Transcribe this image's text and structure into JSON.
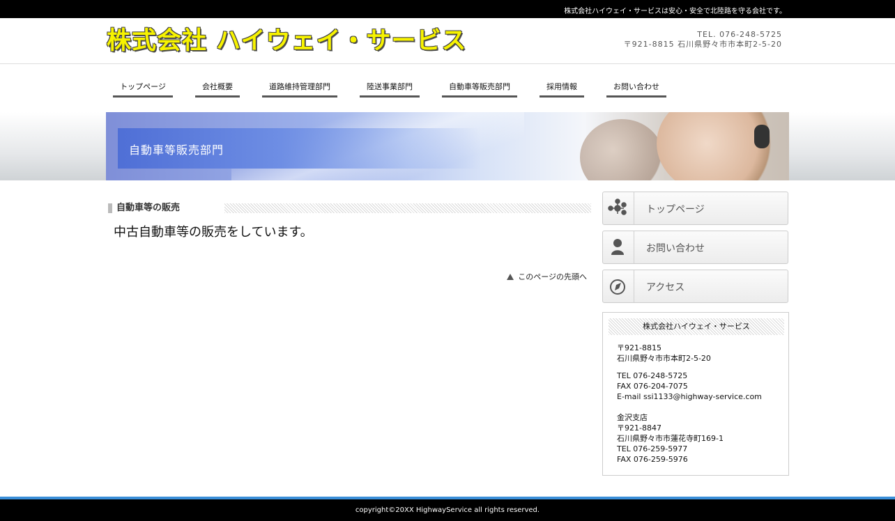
{
  "topbar": {
    "tagline": "株式会社ハイウェイ・サービスは安心・安全で北陸路を守る会社です。"
  },
  "header": {
    "logo": "株式会社 ハイウェイ・サービス",
    "tel": "TEL. 076-248-5725",
    "address": "〒921-8815 石川県野々市市本町2-5-20"
  },
  "nav": [
    {
      "label": "トップページ"
    },
    {
      "label": "会社概要"
    },
    {
      "label": "道路維持管理部門"
    },
    {
      "label": "陸送事業部門"
    },
    {
      "label": "自動車等販売部門"
    },
    {
      "label": "採用情報"
    },
    {
      "label": "お問い合わせ"
    }
  ],
  "banner": {
    "title": "自動車等販売部門"
  },
  "main": {
    "heading": "自動車等の販売",
    "lead": "中古自動車等の販売をしています。",
    "page_top": "このページの先頭へ"
  },
  "sidebar": {
    "buttons": [
      {
        "label": "トップページ",
        "icon": "network-icon"
      },
      {
        "label": "お問い合わせ",
        "icon": "person-icon"
      },
      {
        "label": "アクセス",
        "icon": "compass-icon"
      }
    ],
    "info": {
      "title": "株式会社ハイウェイ・サービス",
      "lines": [
        "〒921-8815",
        "石川県野々市市本町2-5-20",
        "TEL 076-248-5725",
        "FAX 076-204-7075",
        "E-mail ssi1133@highway-service.com",
        "金沢支店",
        "〒921-8847",
        "石川県野々市市蓮花寺町169-1",
        "TEL 076-259-5977",
        "FAX 076-259-5976"
      ]
    }
  },
  "footer": {
    "copyright": "copyright©20XX HighwayService all rights reserved."
  },
  "colors": {
    "accent": "#3a8ed8",
    "logo": "#f7f300"
  }
}
